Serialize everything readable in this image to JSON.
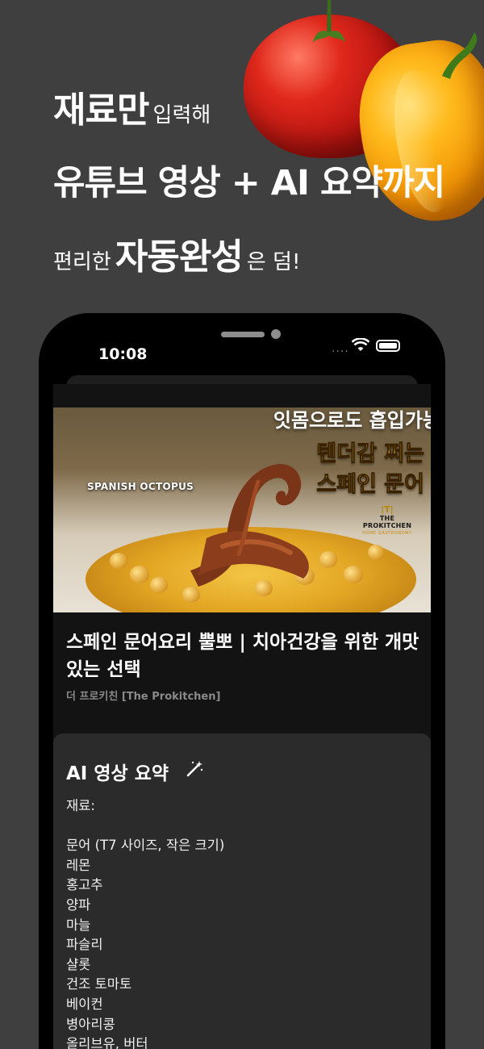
{
  "headline": {
    "line1_bold": "재료만",
    "line1_regular": "입력해",
    "line2_bold": "유튜브 영상 + AI 요약까지",
    "line3_regular_before": "편리한",
    "line3_bold": "자동완성",
    "line3_regular_after": "은 덤!"
  },
  "status_bar": {
    "time": "10:08",
    "dots": "....",
    "icons": [
      "wifi-icon",
      "battery-icon"
    ]
  },
  "video": {
    "thumbnail": {
      "tag": "SPANISH OCTOPUS",
      "line1": "잇몸으로도 흡입가능",
      "line2": "텐더감 쩌는",
      "line3": "스페인 문어",
      "brand_mark": "|T|",
      "brand_name": "THE PROKITCHEN",
      "brand_sub": "HOME GASTRONOMY"
    },
    "title": "스페인 문어요리 뿔뽀 | 치아건강을 위한 개맛있는 선택",
    "channel": "더 프로키친 [The Prokitchen]"
  },
  "summary": {
    "title": "AI 영상 요약",
    "icon": "magic-wand-icon",
    "ingredients_label": "재료:",
    "ingredients": [
      "문어 (T7 사이즈, 작은 크기)",
      "레몬",
      "홍고추",
      "양파",
      "마늘",
      "파슬리",
      "샬롯",
      "건조 토마토",
      "베이컨",
      "병아리콩",
      "올리브유, 버터"
    ]
  },
  "colors": {
    "background": "#3f3f3f",
    "phone": "#000000",
    "summary_card": "#2b2b2b",
    "thumbnail_yellow_text": "#f2c21a"
  }
}
